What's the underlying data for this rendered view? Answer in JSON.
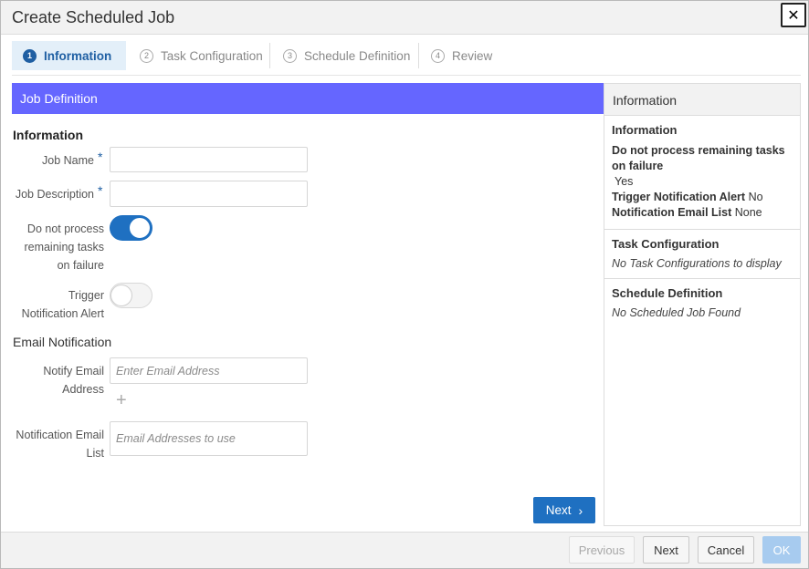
{
  "dialog": {
    "title": "Create Scheduled Job",
    "close_label": "✕"
  },
  "steps": [
    {
      "num": "1",
      "label": "Information",
      "active": true
    },
    {
      "num": "2",
      "label": "Task Configuration",
      "active": false
    },
    {
      "num": "3",
      "label": "Schedule Definition",
      "active": false
    },
    {
      "num": "4",
      "label": "Review",
      "active": false
    }
  ],
  "section": {
    "title": "Job Definition"
  },
  "form": {
    "heading": "Information",
    "job_name": {
      "label": "Job Name",
      "required": "*",
      "value": "",
      "placeholder": ""
    },
    "job_description": {
      "label": "Job Description",
      "required": "*",
      "value": "",
      "placeholder": ""
    },
    "no_process_toggle": {
      "label": "Do not process remaining tasks on failure",
      "state": "on"
    },
    "trigger_toggle": {
      "label": "Trigger Notification Alert",
      "state": "off"
    },
    "email_heading": "Email Notification",
    "notify_email": {
      "label": "Notify Email Address",
      "value": "",
      "placeholder": "Enter Email Address",
      "add_icon": "+"
    },
    "notification_list": {
      "label": "Notification Email List",
      "value": "",
      "placeholder": "Email Addresses to use"
    },
    "next_label": "Next",
    "next_icon": "›"
  },
  "info_panel": {
    "header": "Information",
    "information": {
      "title": "Information",
      "no_process_label": "Do not process remaining tasks on failure",
      "no_process_value": "Yes",
      "trigger_label": "Trigger Notification Alert",
      "trigger_value": "No",
      "email_list_label": "Notification Email List",
      "email_list_value": "None"
    },
    "task_config": {
      "title": "Task Configuration",
      "empty": "No Task Configurations to display"
    },
    "schedule": {
      "title": "Schedule Definition",
      "empty": "No Scheduled Job Found"
    }
  },
  "footer": {
    "previous": "Previous",
    "next": "Next",
    "cancel": "Cancel",
    "ok": "OK"
  },
  "colors": {
    "accent": "#1f70c1",
    "section_bar": "#6566ff",
    "ok_disabled": "#a7cbef"
  }
}
